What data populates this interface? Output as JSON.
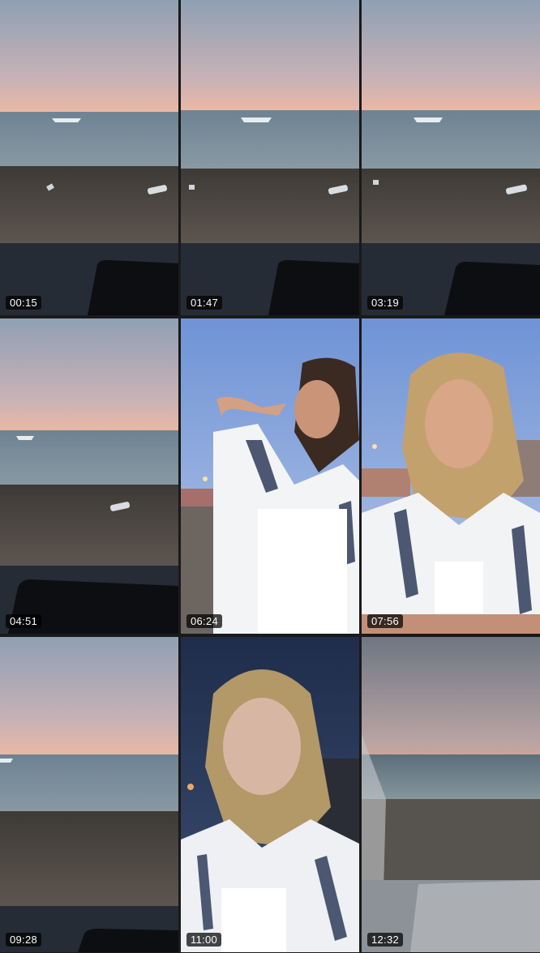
{
  "gallery": {
    "thumbnails": [
      {
        "timestamp": "00:15",
        "scene": "beach"
      },
      {
        "timestamp": "01:47",
        "scene": "beach"
      },
      {
        "timestamp": "03:19",
        "scene": "beach"
      },
      {
        "timestamp": "04:51",
        "scene": "beach"
      },
      {
        "timestamp": "06:24",
        "scene": "selfie-day"
      },
      {
        "timestamp": "07:56",
        "scene": "selfie-day"
      },
      {
        "timestamp": "09:28",
        "scene": "beach"
      },
      {
        "timestamp": "11:00",
        "scene": "selfie-dusk"
      },
      {
        "timestamp": "12:32",
        "scene": "beach-blur"
      }
    ]
  },
  "colors": {
    "sky_top": "#8a9bb0",
    "sky_horizon": "#e8b7a4",
    "sea": "#6f8492",
    "sand": "#4a4540",
    "dark_fg": "#1e232a",
    "timestamp_bg": "#000000"
  }
}
